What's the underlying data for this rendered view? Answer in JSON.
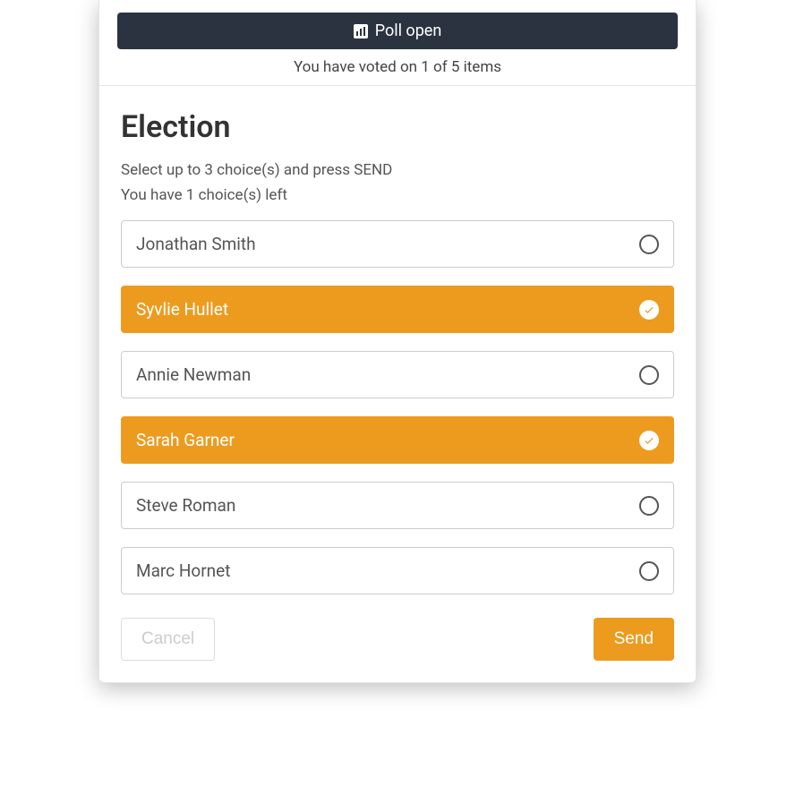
{
  "header": {
    "poll_status": "Poll open",
    "voted_text": "You have voted on 1 of 5 items"
  },
  "poll": {
    "title": "Election",
    "instructions": "Select up to 3 choice(s) and press SEND",
    "remaining": "You have 1 choice(s) left"
  },
  "options": [
    {
      "label": "Jonathan Smith",
      "selected": false
    },
    {
      "label": "Syvlie Hullet",
      "selected": true
    },
    {
      "label": "Annie Newman",
      "selected": false
    },
    {
      "label": "Sarah Garner",
      "selected": true
    },
    {
      "label": "Steve Roman",
      "selected": false
    },
    {
      "label": "Marc Hornet",
      "selected": false
    }
  ],
  "buttons": {
    "cancel": "Cancel",
    "send": "Send"
  },
  "colors": {
    "accent": "#ed9b1f",
    "darkbar": "#2b3340"
  }
}
